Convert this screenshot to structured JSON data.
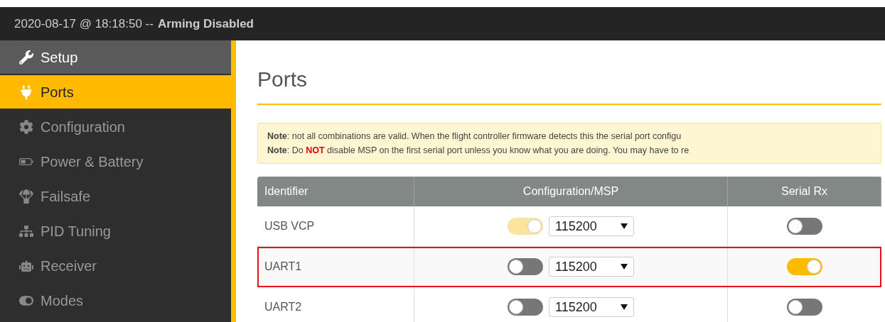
{
  "header": {
    "date": "2020-08-17 @ 18:18:50 --",
    "status": "Arming Disabled"
  },
  "sidebar": {
    "items": [
      {
        "kind": "wrench",
        "label": "Setup",
        "selected": false,
        "hover": true
      },
      {
        "kind": "plug",
        "label": "Ports",
        "selected": true,
        "hover": false
      },
      {
        "kind": "gear",
        "label": "Configuration",
        "selected": false,
        "hover": false
      },
      {
        "kind": "battery",
        "label": "Power & Battery",
        "selected": false,
        "hover": false
      },
      {
        "kind": "parachute",
        "label": "Failsafe",
        "selected": false,
        "hover": false
      },
      {
        "kind": "tree",
        "label": "PID Tuning",
        "selected": false,
        "hover": false
      },
      {
        "kind": "robot",
        "label": "Receiver",
        "selected": false,
        "hover": false
      },
      {
        "kind": "switch",
        "label": "Modes",
        "selected": false,
        "hover": false
      }
    ]
  },
  "page": {
    "title": "Ports",
    "notes": [
      "**Note**: not all combinations are valid. When the flight controller firmware detects this the serial port configu",
      "**Note**: Do **NOT** disable MSP on the first serial port unless you know what you are doing. You may have to re"
    ],
    "table": {
      "columns": [
        "Identifier",
        "Configuration/MSP",
        "Serial Rx"
      ],
      "rows": [
        {
          "identifier": "USB VCP",
          "msp": {
            "on": true,
            "disabled": true
          },
          "baud": "115200",
          "serial_rx": {
            "on": false
          },
          "highlighted": false
        },
        {
          "identifier": "UART1",
          "msp": {
            "on": false,
            "disabled": false
          },
          "baud": "115200",
          "serial_rx": {
            "on": true
          },
          "highlighted": true
        },
        {
          "identifier": "UART2",
          "msp": {
            "on": false,
            "disabled": false
          },
          "baud": "115200",
          "serial_rx": {
            "on": false
          },
          "highlighted": false
        }
      ]
    }
  }
}
